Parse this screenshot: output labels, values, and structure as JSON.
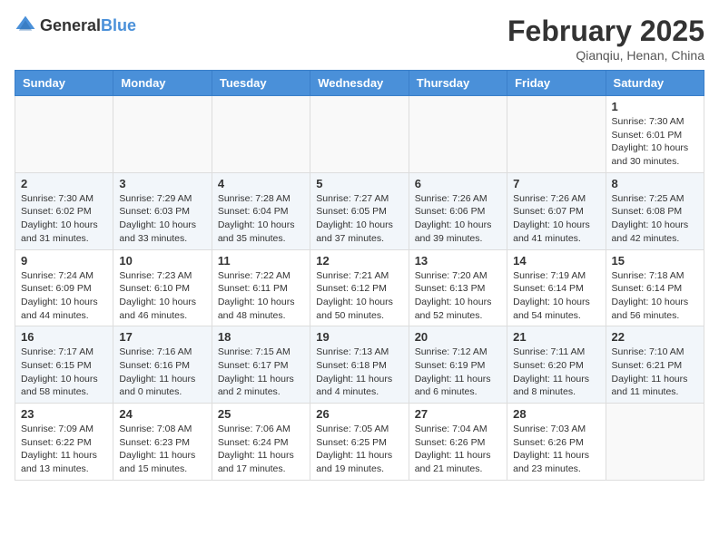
{
  "logo": {
    "general": "General",
    "blue": "Blue"
  },
  "title": "February 2025",
  "location": "Qianqiu, Henan, China",
  "weekdays": [
    "Sunday",
    "Monday",
    "Tuesday",
    "Wednesday",
    "Thursday",
    "Friday",
    "Saturday"
  ],
  "weeks": [
    [
      {
        "day": "",
        "info": ""
      },
      {
        "day": "",
        "info": ""
      },
      {
        "day": "",
        "info": ""
      },
      {
        "day": "",
        "info": ""
      },
      {
        "day": "",
        "info": ""
      },
      {
        "day": "",
        "info": ""
      },
      {
        "day": "1",
        "info": "Sunrise: 7:30 AM\nSunset: 6:01 PM\nDaylight: 10 hours and 30 minutes."
      }
    ],
    [
      {
        "day": "2",
        "info": "Sunrise: 7:30 AM\nSunset: 6:02 PM\nDaylight: 10 hours and 31 minutes."
      },
      {
        "day": "3",
        "info": "Sunrise: 7:29 AM\nSunset: 6:03 PM\nDaylight: 10 hours and 33 minutes."
      },
      {
        "day": "4",
        "info": "Sunrise: 7:28 AM\nSunset: 6:04 PM\nDaylight: 10 hours and 35 minutes."
      },
      {
        "day": "5",
        "info": "Sunrise: 7:27 AM\nSunset: 6:05 PM\nDaylight: 10 hours and 37 minutes."
      },
      {
        "day": "6",
        "info": "Sunrise: 7:26 AM\nSunset: 6:06 PM\nDaylight: 10 hours and 39 minutes."
      },
      {
        "day": "7",
        "info": "Sunrise: 7:26 AM\nSunset: 6:07 PM\nDaylight: 10 hours and 41 minutes."
      },
      {
        "day": "8",
        "info": "Sunrise: 7:25 AM\nSunset: 6:08 PM\nDaylight: 10 hours and 42 minutes."
      }
    ],
    [
      {
        "day": "9",
        "info": "Sunrise: 7:24 AM\nSunset: 6:09 PM\nDaylight: 10 hours and 44 minutes."
      },
      {
        "day": "10",
        "info": "Sunrise: 7:23 AM\nSunset: 6:10 PM\nDaylight: 10 hours and 46 minutes."
      },
      {
        "day": "11",
        "info": "Sunrise: 7:22 AM\nSunset: 6:11 PM\nDaylight: 10 hours and 48 minutes."
      },
      {
        "day": "12",
        "info": "Sunrise: 7:21 AM\nSunset: 6:12 PM\nDaylight: 10 hours and 50 minutes."
      },
      {
        "day": "13",
        "info": "Sunrise: 7:20 AM\nSunset: 6:13 PM\nDaylight: 10 hours and 52 minutes."
      },
      {
        "day": "14",
        "info": "Sunrise: 7:19 AM\nSunset: 6:14 PM\nDaylight: 10 hours and 54 minutes."
      },
      {
        "day": "15",
        "info": "Sunrise: 7:18 AM\nSunset: 6:14 PM\nDaylight: 10 hours and 56 minutes."
      }
    ],
    [
      {
        "day": "16",
        "info": "Sunrise: 7:17 AM\nSunset: 6:15 PM\nDaylight: 10 hours and 58 minutes."
      },
      {
        "day": "17",
        "info": "Sunrise: 7:16 AM\nSunset: 6:16 PM\nDaylight: 11 hours and 0 minutes."
      },
      {
        "day": "18",
        "info": "Sunrise: 7:15 AM\nSunset: 6:17 PM\nDaylight: 11 hours and 2 minutes."
      },
      {
        "day": "19",
        "info": "Sunrise: 7:13 AM\nSunset: 6:18 PM\nDaylight: 11 hours and 4 minutes."
      },
      {
        "day": "20",
        "info": "Sunrise: 7:12 AM\nSunset: 6:19 PM\nDaylight: 11 hours and 6 minutes."
      },
      {
        "day": "21",
        "info": "Sunrise: 7:11 AM\nSunset: 6:20 PM\nDaylight: 11 hours and 8 minutes."
      },
      {
        "day": "22",
        "info": "Sunrise: 7:10 AM\nSunset: 6:21 PM\nDaylight: 11 hours and 11 minutes."
      }
    ],
    [
      {
        "day": "23",
        "info": "Sunrise: 7:09 AM\nSunset: 6:22 PM\nDaylight: 11 hours and 13 minutes."
      },
      {
        "day": "24",
        "info": "Sunrise: 7:08 AM\nSunset: 6:23 PM\nDaylight: 11 hours and 15 minutes."
      },
      {
        "day": "25",
        "info": "Sunrise: 7:06 AM\nSunset: 6:24 PM\nDaylight: 11 hours and 17 minutes."
      },
      {
        "day": "26",
        "info": "Sunrise: 7:05 AM\nSunset: 6:25 PM\nDaylight: 11 hours and 19 minutes."
      },
      {
        "day": "27",
        "info": "Sunrise: 7:04 AM\nSunset: 6:26 PM\nDaylight: 11 hours and 21 minutes."
      },
      {
        "day": "28",
        "info": "Sunrise: 7:03 AM\nSunset: 6:26 PM\nDaylight: 11 hours and 23 minutes."
      },
      {
        "day": "",
        "info": ""
      }
    ]
  ]
}
